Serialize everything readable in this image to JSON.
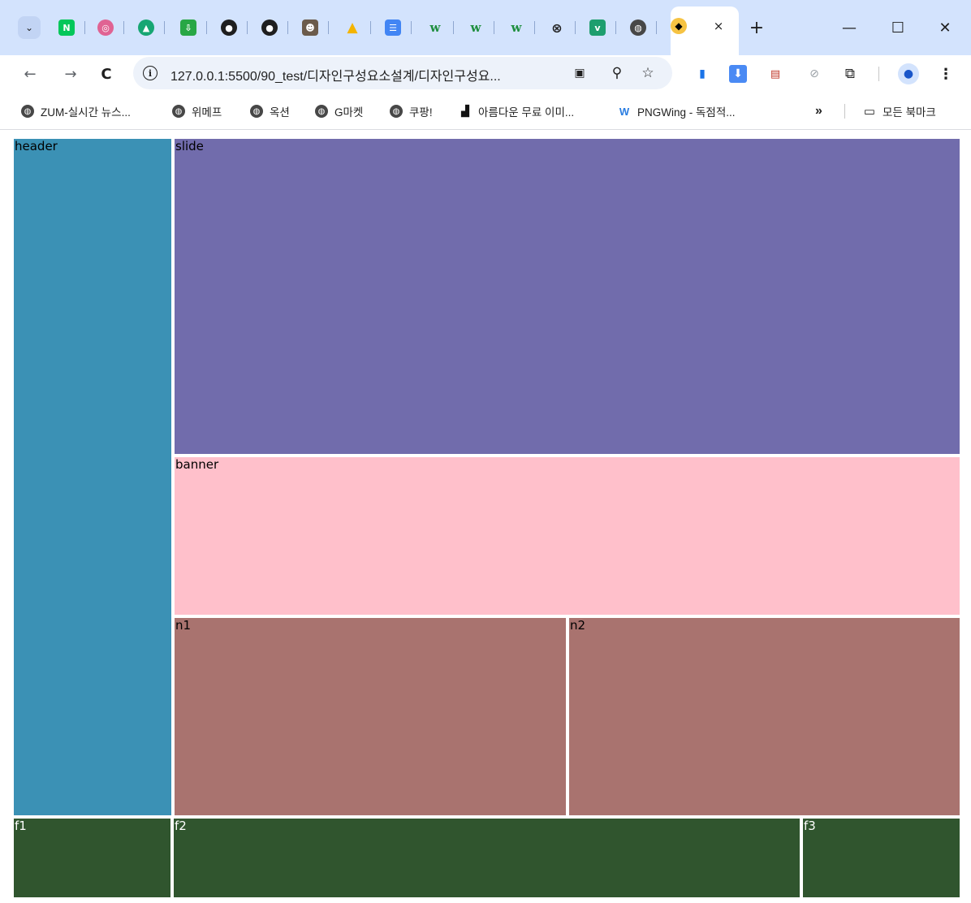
{
  "browser": {
    "tabs": {
      "favicons": [
        "naver-icon",
        "donut-icon",
        "graduation-cap-icon",
        "download-tray-icon",
        "github-icon",
        "github-icon",
        "person-icon",
        "google-drive-icon",
        "docs-icon",
        "w-icon",
        "w-icon",
        "w-icon",
        "codepen-icon",
        "v-icon",
        "globe-icon"
      ],
      "active_close": "×",
      "new_tab": "+"
    },
    "window": {
      "minimize": "—",
      "maximize": "☐",
      "close": "✕"
    },
    "toolbar": {
      "back": "←",
      "forward": "→",
      "reload": "C",
      "url": "127.0.0.1:5500/90_test/디자인구성요소설계/디자인구성요...",
      "more": "⋮"
    },
    "bookmarks": [
      {
        "label": "ZUM-실시간 뉴스...",
        "icon": "globe-icon"
      },
      {
        "label": "위메프",
        "icon": "globe-icon"
      },
      {
        "label": "옥션",
        "icon": "globe-icon"
      },
      {
        "label": "G마켓",
        "icon": "globe-icon"
      },
      {
        "label": "쿠팡!",
        "icon": "globe-icon"
      },
      {
        "label": "아름다운 무료 이미...",
        "icon": "unsplash-icon"
      },
      {
        "label": "PNGWing - 독점적...",
        "icon": "pngwing-icon"
      }
    ],
    "bookmarks_overflow": "»",
    "all_bookmarks": "모든 북마크"
  },
  "page": {
    "header": {
      "label": "header",
      "color": "#3b91b5"
    },
    "slide": {
      "label": "slide",
      "color": "#716cac"
    },
    "banner": {
      "label": "banner",
      "color": "#ffc0cb"
    },
    "n1": {
      "label": "n1",
      "color": "#a9736f"
    },
    "n2": {
      "label": "n2",
      "color": "#a9736f"
    },
    "f1": {
      "label": "f1",
      "color": "#30552e"
    },
    "f2": {
      "label": "f2",
      "color": "#30552e"
    },
    "f3": {
      "label": "f3",
      "color": "#30552e"
    }
  }
}
